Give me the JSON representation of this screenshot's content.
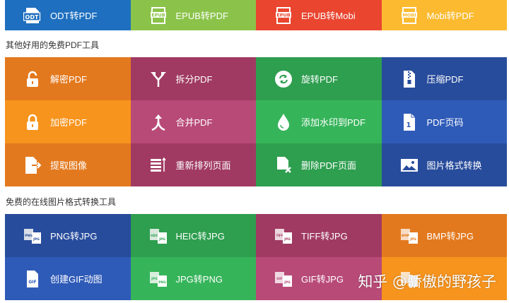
{
  "top_row": [
    {
      "label": "ODT转PDF",
      "icon": "odt-file-icon",
      "color": "#1e6fbf"
    },
    {
      "label": "EPUB转PDF",
      "icon": "epub-file-icon",
      "color": "#8bc34a"
    },
    {
      "label": "EPUB转Mobi",
      "icon": "epub-file-icon",
      "color": "#e9452f"
    },
    {
      "label": "Mobi转PDF",
      "icon": "mobi-file-icon",
      "color": "#fbba2f"
    }
  ],
  "sections": {
    "pdf_tools_title": "其他好用的免费PDF工具",
    "image_tools_title": "免费的在线图片格式转换工具"
  },
  "pdf_tools": [
    {
      "label": "解密PDF",
      "icon": "unlock-icon",
      "color": "#e3791e"
    },
    {
      "label": "拆分PDF",
      "icon": "split-arrow-icon",
      "color": "#a03a62"
    },
    {
      "label": "旋转PDF",
      "icon": "rotate-icon",
      "color": "#2e9e4f"
    },
    {
      "label": "压缩PDF",
      "icon": "zip-file-icon",
      "color": "#284c9c"
    },
    {
      "label": "加密PDF",
      "icon": "lock-icon",
      "color": "#f7941d"
    },
    {
      "label": "合并PDF",
      "icon": "merge-arrow-icon",
      "color": "#b84a78"
    },
    {
      "label": "添加水印到PDF",
      "icon": "water-drop-icon",
      "color": "#36b45a"
    },
    {
      "label": "PDF页码",
      "icon": "page-number-icon",
      "color": "#2f5bb8"
    },
    {
      "label": "提取图像",
      "icon": "extract-icon",
      "color": "#e3791e"
    },
    {
      "label": "重新排列页面",
      "icon": "reorder-list-icon",
      "color": "#a03a62"
    },
    {
      "label": "删除PDF页面",
      "icon": "delete-page-icon",
      "color": "#2e9e4f"
    },
    {
      "label": "图片格式转换",
      "icon": "image-icon",
      "color": "#284c9c"
    }
  ],
  "image_tools": [
    {
      "label": "PNG转JPG",
      "icon": "png-jpg-icon",
      "from": "PNG",
      "to": "JPG",
      "color": "#284c9c"
    },
    {
      "label": "HEIC转JPG",
      "icon": "heic-jpg-icon",
      "from": "HEIC",
      "to": "JPG",
      "color": "#2e9e4f"
    },
    {
      "label": "TIFF转JPG",
      "icon": "tiff-jpg-icon",
      "from": "TIFF",
      "to": "JPG",
      "color": "#a03a62"
    },
    {
      "label": "BMP转JPG",
      "icon": "bmp-jpg-icon",
      "from": "BMP",
      "to": "JPG",
      "color": "#e3791e"
    },
    {
      "label": "创建GIF动图",
      "icon": "gif-file-icon",
      "from": "GIF",
      "color": "#2f5bb8"
    },
    {
      "label": "JPG转PNG",
      "icon": "jpg-png-icon",
      "from": "JPG",
      "to": "PNG",
      "color": "#36b45a"
    },
    {
      "label": "GIF转JPG",
      "icon": "gif-jpg-icon",
      "from": "GIF",
      "to": "JPG",
      "color": "#b84a78"
    },
    {
      "label": "",
      "icon": "file-pair-icon",
      "from": "",
      "to": "",
      "color": "#f7941d"
    }
  ],
  "watermark": "知乎 @骄傲的野孩子"
}
